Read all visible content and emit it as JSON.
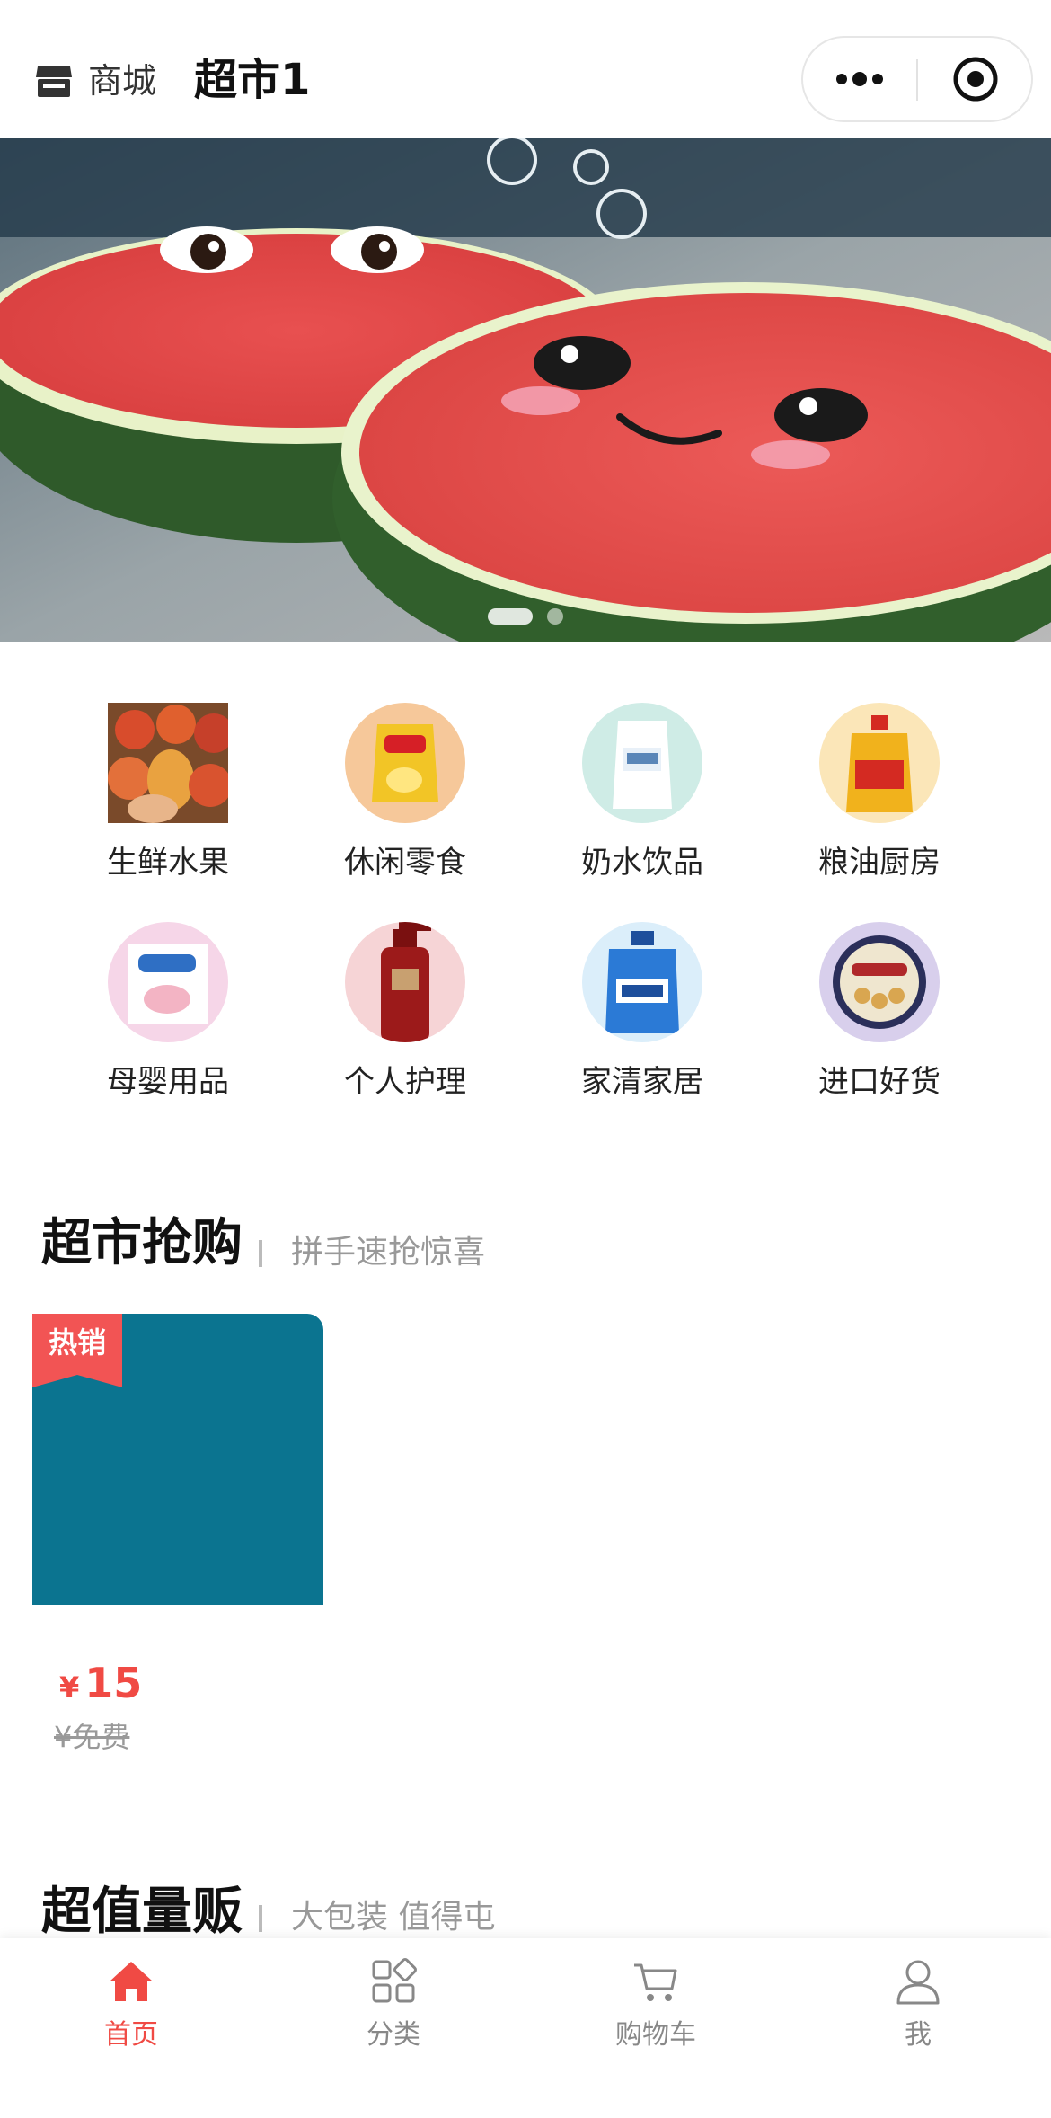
{
  "header": {
    "shop_label": "商城",
    "title": "超市1",
    "shop_icon": "store-icon",
    "more_icon": "more-dots-icon",
    "close_icon": "target-circle-icon"
  },
  "banner": {
    "slide_count": 2,
    "active_slide": 1
  },
  "categories": [
    {
      "label": "生鲜水果",
      "icon": "fruit-icon"
    },
    {
      "label": "休闲零食",
      "icon": "snack-icon"
    },
    {
      "label": "奶水饮品",
      "icon": "milk-icon"
    },
    {
      "label": "粮油厨房",
      "icon": "oil-bottle-icon"
    },
    {
      "label": "母婴用品",
      "icon": "diaper-icon"
    },
    {
      "label": "个人护理",
      "icon": "shampoo-icon"
    },
    {
      "label": "家清家居",
      "icon": "detergent-icon"
    },
    {
      "label": "进口好货",
      "icon": "cookie-tin-icon"
    }
  ],
  "flash_sale": {
    "title": "超市抢购",
    "subtitle": "拼手速抢惊喜",
    "product": {
      "tag": "热销",
      "currency": "¥",
      "price": "15",
      "original_price": "¥免费"
    }
  },
  "bulk_deal": {
    "title": "超值量贩",
    "subtitle": "大包装 值得屯"
  },
  "tabbar": {
    "items": [
      {
        "label": "首页",
        "icon": "home-icon",
        "active": true
      },
      {
        "label": "分类",
        "icon": "category-grid-icon",
        "active": false
      },
      {
        "label": "购物车",
        "icon": "cart-icon",
        "active": false
      },
      {
        "label": "我",
        "icon": "user-icon",
        "active": false
      }
    ]
  },
  "colors": {
    "accent": "#f04a44",
    "product_bg": "#0b7490",
    "muted_text": "#999999"
  }
}
